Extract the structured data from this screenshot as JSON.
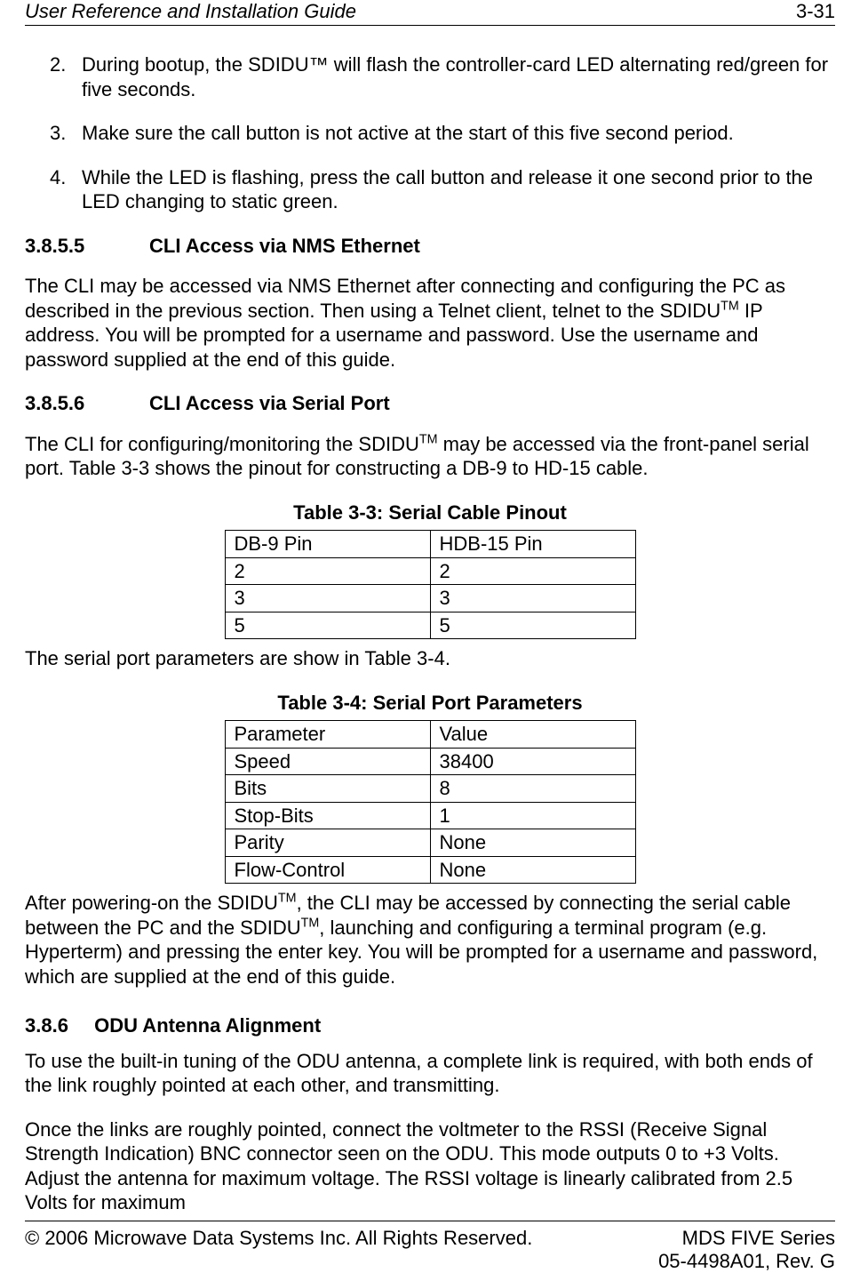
{
  "header": {
    "title_left": "User Reference and Installation Guide",
    "page_num": "3-31"
  },
  "list": {
    "item2_num": "2.",
    "item2_text": "During bootup, the SDIDU™ will flash the controller-card LED alternating red/green for five seconds.",
    "item3_num": "3.",
    "item3_text": "Make sure the call button is not active at the start of this five second period.",
    "item4_num": "4.",
    "item4_text": "While the LED is flashing, press the call button and release it one second prior to the LED changing to static green."
  },
  "sec_3855": {
    "num": "3.8.5.5",
    "title": "CLI Access via NMS Ethernet",
    "p1_a": "The CLI may be accessed via NMS Ethernet after connecting and configuring the PC as described in the previous section. Then using a Telnet client, telnet to the SDIDU",
    "p1_tm": "TM",
    "p1_b": " IP address. You will be prompted for a username and password.  Use the username and password supplied at the end of this guide."
  },
  "sec_3856": {
    "num": "3.8.5.6",
    "title": "CLI Access via Serial Port",
    "p1_a": "The CLI for configuring/monitoring the SDIDU",
    "p1_tm": "TM",
    "p1_b": " may be accessed via the front-panel serial port. Table 3-3 shows the pinout for constructing a DB-9 to HD-15 cable.",
    "table33_caption": "Table 3-3: Serial Cable Pinout",
    "table33": {
      "h1": "DB-9 Pin",
      "h2": "HDB-15 Pin",
      "r1c1": "2",
      "r1c2": "2",
      "r2c1": "3",
      "r2c2": "3",
      "r3c1": "5",
      "r3c2": "5"
    },
    "p2": "The serial port parameters are show in Table 3-4.",
    "table34_caption": "Table 3-4: Serial Port Parameters",
    "table34": {
      "h1": "Parameter",
      "h2": "Value",
      "r1c1": "Speed",
      "r1c2": "38400",
      "r2c1": "Bits",
      "r2c2": "8",
      "r3c1": "Stop-Bits",
      "r3c2": "1",
      "r4c1": "Parity",
      "r4c2": "None",
      "r5c1": "Flow-Control",
      "r5c2": "None"
    },
    "p3_a": "After powering-on the SDIDU",
    "p3_tm1": "TM",
    "p3_b": ", the CLI may be accessed by connecting the serial cable between the PC and the SDIDU",
    "p3_tm2": "TM",
    "p3_c": ", launching and configuring a terminal program (e.g. Hyperterm) and pressing the enter key. You will be prompted for a username and password, which are supplied at the end of this guide."
  },
  "sec_386": {
    "num": "3.8.6",
    "title": "ODU Antenna Alignment",
    "p1": "To use the built-in tuning of the ODU antenna, a complete link is required, with both ends of the link roughly pointed at each other, and transmitting.",
    "p2": "Once the links are roughly pointed, connect the voltmeter to the RSSI (Receive Signal Strength Indication) BNC connector seen on the ODU.  This mode outputs 0 to +3 Volts.  Adjust the antenna for maximum voltage. The RSSI voltage is linearly calibrated from 2.5 Volts for maximum"
  },
  "footer": {
    "left": "© 2006 Microwave Data Systems Inc.  All Rights Reserved.",
    "right1": "MDS FIVE Series",
    "right2": "05-4498A01, Rev. G"
  }
}
